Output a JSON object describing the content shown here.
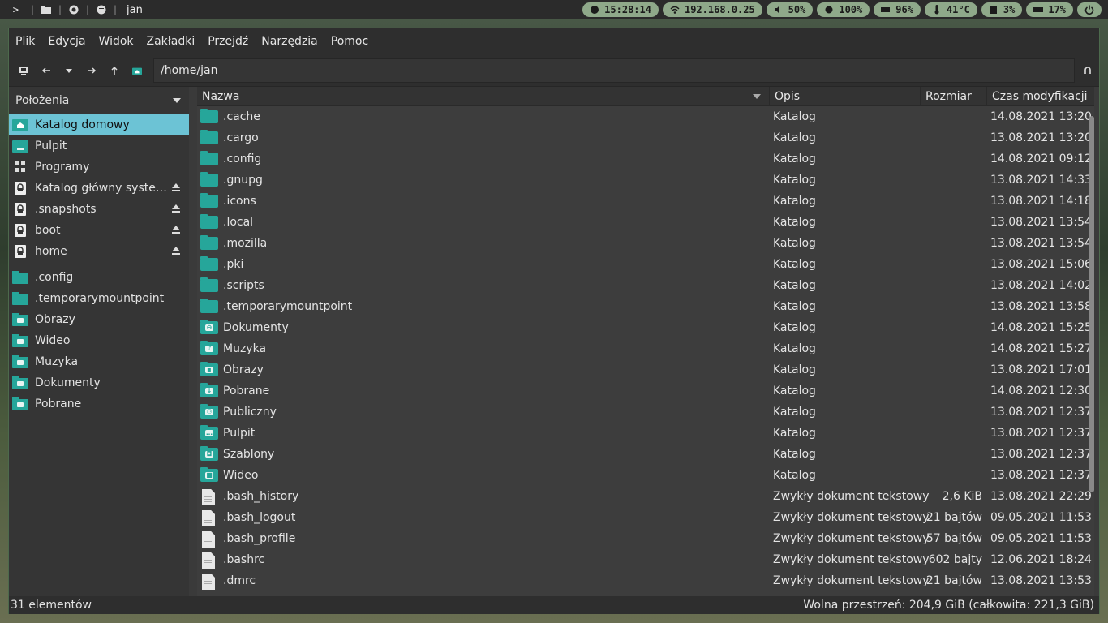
{
  "topbar": {
    "window_title": "jan",
    "clock": "15:28:14",
    "ip": "192.168.0.25",
    "volume": "50%",
    "brightness": "100%",
    "battery": "96%",
    "temp": "41°C",
    "cpu": "3%",
    "ram": "17%"
  },
  "menu": [
    "Plik",
    "Edycja",
    "Widok",
    "Zakładki",
    "Przejdź",
    "Narzędzia",
    "Pomoc"
  ],
  "path": "/home/jan",
  "sidebar": {
    "header": "Położenia",
    "places": [
      {
        "label": "Katalog domowy",
        "icon": "home-icon",
        "selected": true
      },
      {
        "label": "Pulpit",
        "icon": "desktop-icon"
      },
      {
        "label": "Programy",
        "icon": "apps-icon"
      },
      {
        "label": "Katalog główny syste…",
        "icon": "drive-icon",
        "eject": true
      },
      {
        "label": ".snapshots",
        "icon": "drive-icon",
        "eject": true
      },
      {
        "label": "boot",
        "icon": "drive-icon",
        "eject": true
      },
      {
        "label": "home",
        "icon": "drive-icon",
        "eject": true
      }
    ],
    "bookmarks": [
      {
        "label": ".config",
        "icon": "folder-icon"
      },
      {
        "label": ".temporarymountpoint",
        "icon": "folder-icon"
      },
      {
        "label": "Obrazy",
        "icon": "folder-pictures-icon"
      },
      {
        "label": "Wideo",
        "icon": "folder-videos-icon"
      },
      {
        "label": "Muzyka",
        "icon": "folder-music-icon"
      },
      {
        "label": "Dokumenty",
        "icon": "folder-documents-icon"
      },
      {
        "label": "Pobrane",
        "icon": "folder-download-icon"
      }
    ]
  },
  "columns": {
    "name": "Nazwa",
    "desc": "Opis",
    "size": "Rozmiar",
    "time": "Czas modyfikacji"
  },
  "files": [
    {
      "name": ".cache",
      "desc": "Katalog",
      "size": "",
      "time": "14.08.2021 13:20",
      "type": "folder"
    },
    {
      "name": ".cargo",
      "desc": "Katalog",
      "size": "",
      "time": "13.08.2021 13:20",
      "type": "folder"
    },
    {
      "name": ".config",
      "desc": "Katalog",
      "size": "",
      "time": "14.08.2021 09:12",
      "type": "folder"
    },
    {
      "name": ".gnupg",
      "desc": "Katalog",
      "size": "",
      "time": "13.08.2021 14:33",
      "type": "folder"
    },
    {
      "name": ".icons",
      "desc": "Katalog",
      "size": "",
      "time": "13.08.2021 14:18",
      "type": "folder"
    },
    {
      "name": ".local",
      "desc": "Katalog",
      "size": "",
      "time": "13.08.2021 13:54",
      "type": "folder"
    },
    {
      "name": ".mozilla",
      "desc": "Katalog",
      "size": "",
      "time": "13.08.2021 13:54",
      "type": "folder"
    },
    {
      "name": ".pki",
      "desc": "Katalog",
      "size": "",
      "time": "13.08.2021 15:06",
      "type": "folder"
    },
    {
      "name": ".scripts",
      "desc": "Katalog",
      "size": "",
      "time": "13.08.2021 14:02",
      "type": "folder"
    },
    {
      "name": ".temporarymountpoint",
      "desc": "Katalog",
      "size": "",
      "time": "13.08.2021 13:58",
      "type": "folder"
    },
    {
      "name": "Dokumenty",
      "desc": "Katalog",
      "size": "",
      "time": "14.08.2021 15:25",
      "type": "folder",
      "emblem": "⊖"
    },
    {
      "name": "Muzyka",
      "desc": "Katalog",
      "size": "",
      "time": "14.08.2021 15:27",
      "type": "folder",
      "emblem": "♪"
    },
    {
      "name": "Obrazy",
      "desc": "Katalog",
      "size": "",
      "time": "13.08.2021 17:01",
      "type": "folder",
      "emblem": "▪"
    },
    {
      "name": "Pobrane",
      "desc": "Katalog",
      "size": "",
      "time": "14.08.2021 12:30",
      "type": "folder",
      "emblem": "↓"
    },
    {
      "name": "Publiczny",
      "desc": "Katalog",
      "size": "",
      "time": "13.08.2021 12:37",
      "type": "folder",
      "emblem": "⚇"
    },
    {
      "name": "Pulpit",
      "desc": "Katalog",
      "size": "",
      "time": "13.08.2021 12:37",
      "type": "folder",
      "emblem": "…"
    },
    {
      "name": "Szablony",
      "desc": "Katalog",
      "size": "",
      "time": "13.08.2021 12:37",
      "type": "folder",
      "emblem": "◘"
    },
    {
      "name": "Wideo",
      "desc": "Katalog",
      "size": "",
      "time": "13.08.2021 12:37",
      "type": "folder",
      "emblem": "■"
    },
    {
      "name": ".bash_history",
      "desc": "Zwykły dokument tekstowy",
      "size": "2,6 KiB",
      "time": "13.08.2021 22:29",
      "type": "doc"
    },
    {
      "name": ".bash_logout",
      "desc": "Zwykły dokument tekstowy",
      "size": "21 bajtów",
      "time": "09.05.2021 11:53",
      "type": "doc"
    },
    {
      "name": ".bash_profile",
      "desc": "Zwykły dokument tekstowy",
      "size": "57 bajtów",
      "time": "09.05.2021 11:53",
      "type": "doc"
    },
    {
      "name": ".bashrc",
      "desc": "Zwykły dokument tekstowy",
      "size": "602 bajty",
      "time": "12.06.2021 18:24",
      "type": "doc"
    },
    {
      "name": ".dmrc",
      "desc": "Zwykły dokument tekstowy",
      "size": "21 bajtów",
      "time": "13.08.2021 13:53",
      "type": "doc"
    }
  ],
  "status": {
    "count": "31 elementów",
    "free": "Wolna przestrzeń: 204,9 GiB (całkowita: 221,3 GiB)"
  }
}
